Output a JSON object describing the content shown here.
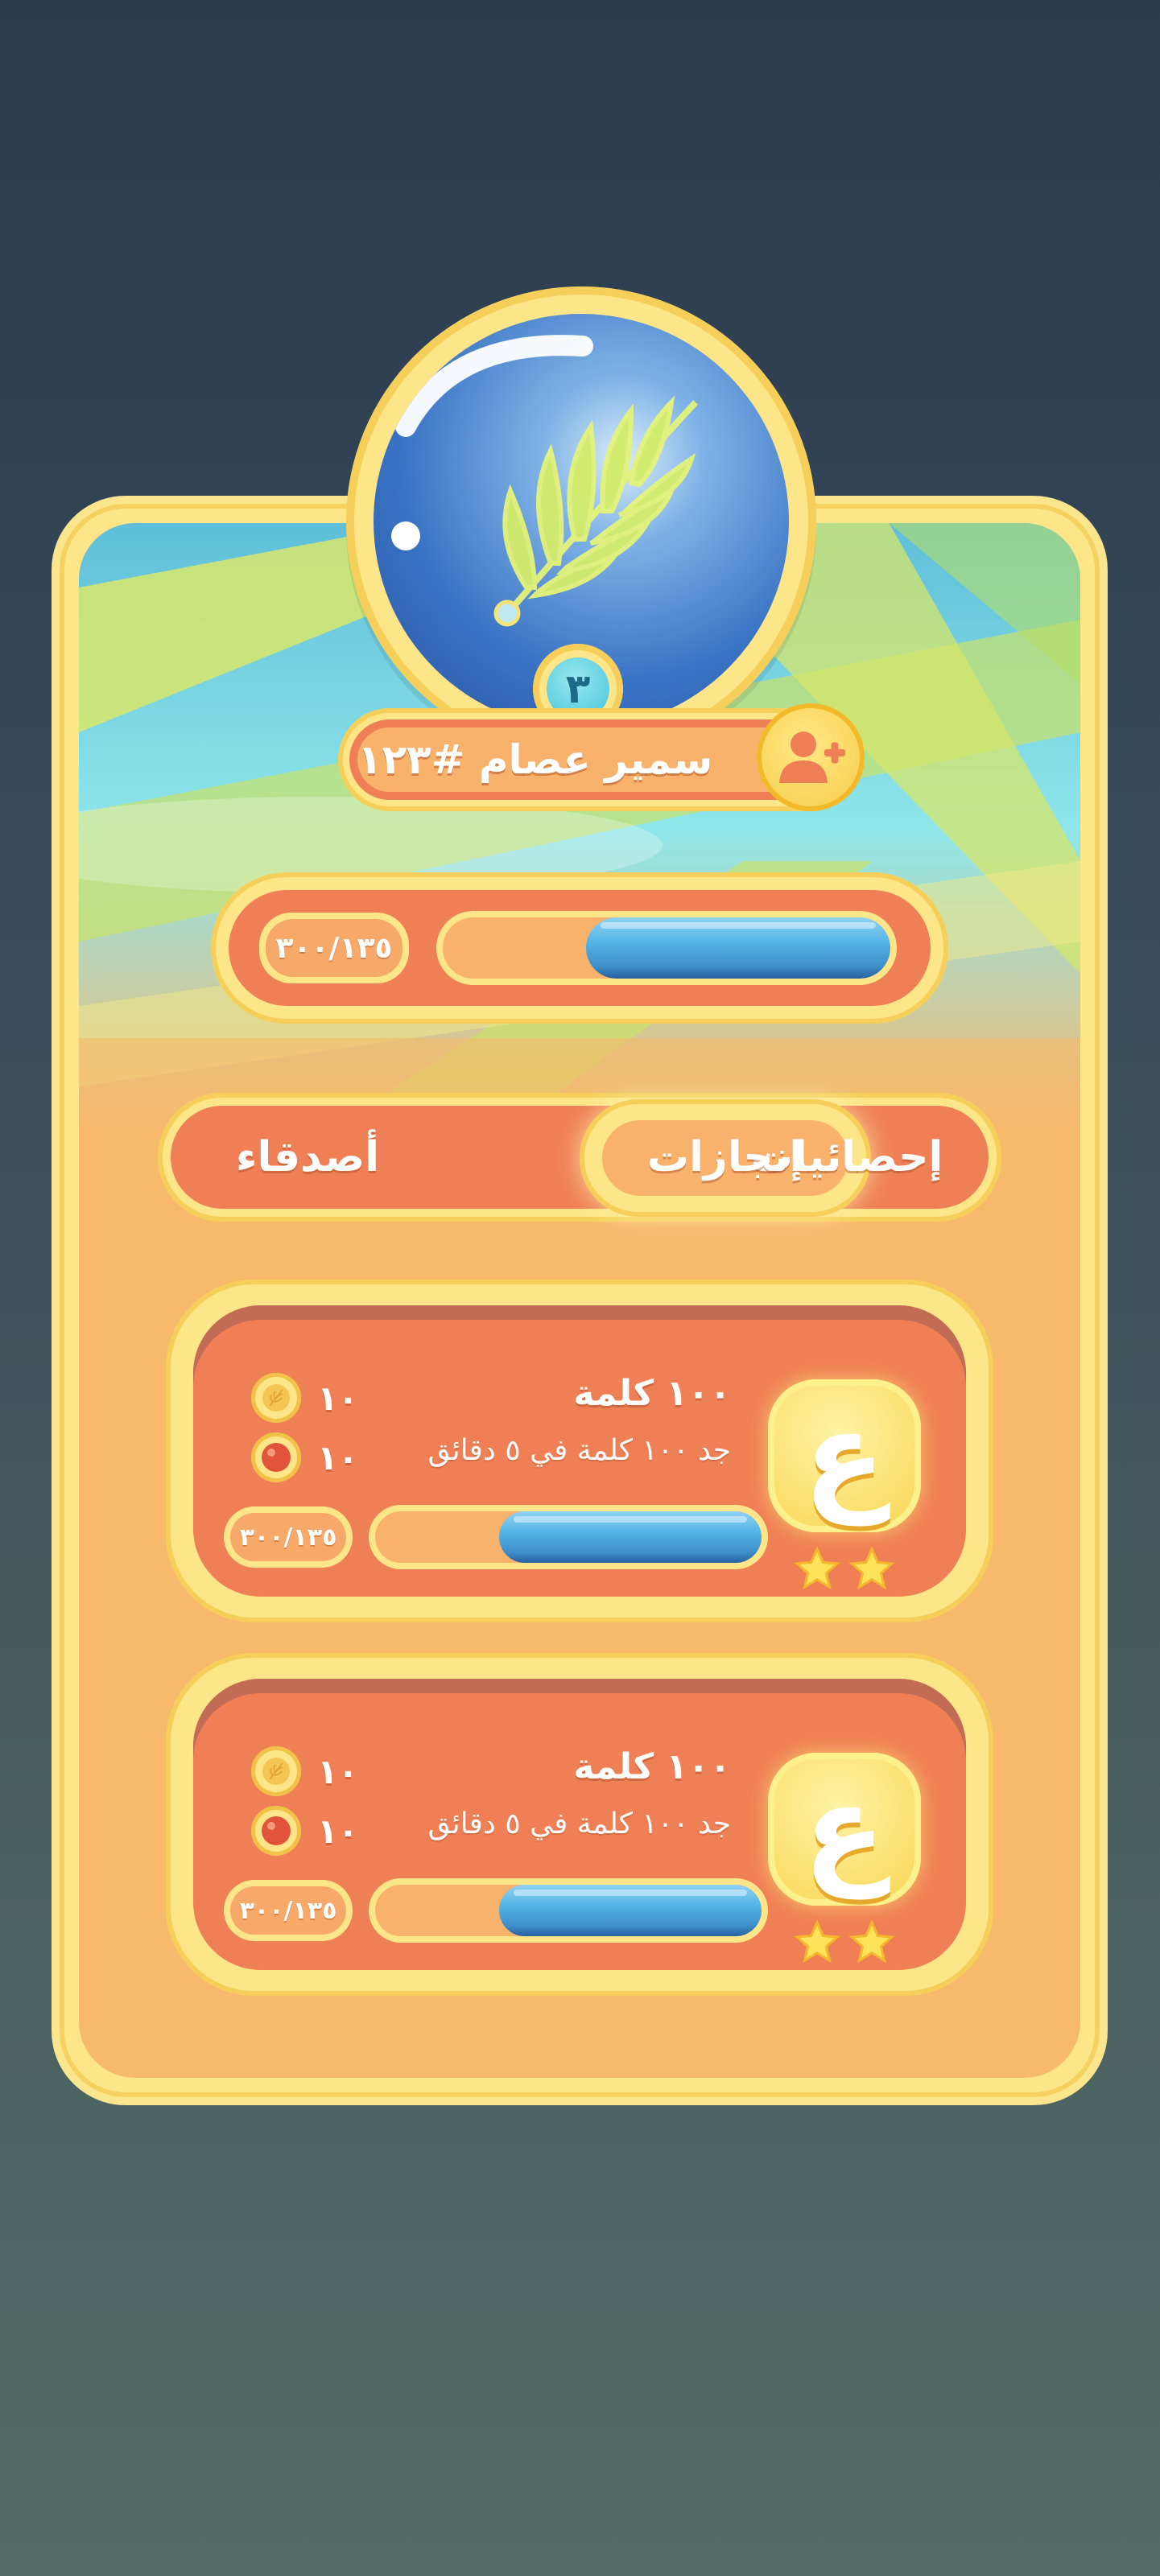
{
  "profile": {
    "player_name": "سمير عصام #١٢٣",
    "level": "٣",
    "xp_text": "٣٠٠/١٣٥",
    "xp_progress": 0.68
  },
  "tabs": {
    "items": [
      "إحصائيات",
      "إنجازات",
      "أصدقاء"
    ],
    "active": "إنجازات"
  },
  "icons": {
    "avatar": "palm-leaf-orb-icon",
    "add_friend": "add-user-icon",
    "reward_1": "leaf-coin-icon",
    "reward_2": "red-orb-icon",
    "star": "star-icon"
  },
  "achievements": [
    {
      "letter": "ع",
      "title": "١٠٠ كلمة",
      "description": "جد ١٠٠ كلمة في ٥ دقائق",
      "reward_leaf": "١٠",
      "reward_orb": "١٠",
      "progress_text": "٣٠٠/١٣٥",
      "progress": 0.68,
      "stars": 2
    },
    {
      "letter": "ع",
      "title": "١٠٠ كلمة",
      "description": "جد ١٠٠ كلمة في ٥ دقائق",
      "reward_leaf": "١٠",
      "reward_orb": "١٠",
      "progress_text": "٣٠٠/١٣٥",
      "progress": 0.68,
      "stars": 2
    }
  ],
  "colors": {
    "panel_orange": "#ef7f55",
    "panel_light": "#f7b96c",
    "frame_yellow": "#fde68a",
    "bar_blue": "#55b4e6"
  }
}
